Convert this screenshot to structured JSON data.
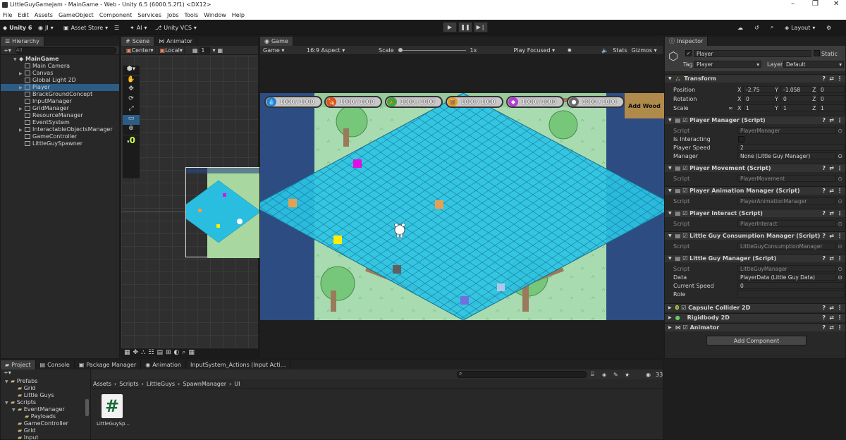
{
  "window": {
    "title": "LittleGuyGamejam - MainGame - Web - Unity 6.5 (6000.5.2f1) <DX12>"
  },
  "menu": [
    "File",
    "Edit",
    "Assets",
    "GameObject",
    "Component",
    "Services",
    "Jobs",
    "Tools",
    "Window",
    "Help"
  ],
  "toolbar": {
    "unity": "Unity 6",
    "account": "JI",
    "asset_store": "Asset Store",
    "ai": "AI",
    "vcs": "Unity VCS",
    "layout": "Layout"
  },
  "hierarchy": {
    "tab": "Hierarchy",
    "search_placeholder": "All",
    "scene": "MainGame",
    "items": [
      "Main Camera",
      "Canvas",
      "Global Light 2D",
      "Player",
      "BrackGroundConcept",
      "InputManager",
      "GridManager",
      "ResourceManager",
      "EventSystem",
      "InteractableObjectsManager",
      "GameController",
      "LittleGuySpawner"
    ]
  },
  "scene": {
    "tab": "Scene",
    "tab2": "Animator",
    "pivot": "Center",
    "space": "Local",
    "grid": "1",
    "zero": "0"
  },
  "game": {
    "tab": "Game",
    "display": "Game",
    "aspect": "16:9 Aspect",
    "scale_label": "Scale",
    "scale_value": "1x",
    "play_mode": "Play Focused",
    "stats": "Stats",
    "gizmos": "Gizmos",
    "hud": [
      "1000 / 1000",
      "1000 / 1000",
      "1000 / 1000",
      "1000 / 1000",
      "1000 / 1000",
      "1000 / 1000"
    ],
    "hud_colors": [
      "#2a7fd4",
      "#d9541a",
      "#3fa83f",
      "#e0a020",
      "#b040d0",
      "#6a6a6a"
    ],
    "add_wood": "Add Wood"
  },
  "inspector": {
    "tab": "Inspector",
    "object_name": "Player",
    "static": "Static",
    "tag_label": "Tag",
    "tag": "Player",
    "layer_label": "Layer",
    "layer": "Default",
    "transform": {
      "title": "Transform",
      "position": {
        "label": "Position",
        "x": "-2.75",
        "y": "-1.058",
        "z": "0"
      },
      "rotation": {
        "label": "Rotation",
        "x": "0",
        "y": "0",
        "z": "0"
      },
      "scale": {
        "label": "Scale",
        "x": "1",
        "y": "1",
        "z": "1"
      }
    },
    "components": [
      {
        "title": "Player Manager (Script)",
        "script": "PlayerManager"
      },
      {
        "title": "Player Movement (Script)",
        "script": "PlayerMovement"
      },
      {
        "title": "Player Animation Manager (Script)",
        "script": "PlayerAnimationManager"
      },
      {
        "title": "Player Interact (Script)",
        "script": "PlayerInteract"
      },
      {
        "title": "Little Guy Consumption Manager (Script)",
        "script": "LittleGuyConsumptionManager"
      },
      {
        "title": "Little Guy Manager (Script)",
        "script": "LittleGuyManager"
      }
    ],
    "script_label": "Script",
    "pm_fields": {
      "is_interacting": "Is Interacting",
      "player_speed": "Player Speed",
      "player_speed_value": "2",
      "manager": "Manager",
      "manager_value": "None (Little Guy Manager)"
    },
    "lgm_fields": {
      "data": "Data",
      "data_value": "PlayerData (Little Guy Data)",
      "current_speed": "Current Speed",
      "current_speed_value": "0",
      "role": "Role"
    },
    "extra": [
      "Capsule Collider 2D",
      "Rigidbody 2D",
      "Animator"
    ],
    "add_component": "Add Component"
  },
  "project": {
    "tabs": [
      "Project",
      "Console",
      "Package Manager",
      "Animation",
      "InputSystem_Actions (Input Acti..."
    ],
    "breadcrumb": [
      "Assets",
      "Scripts",
      "LittleGuys",
      "SpawnManager",
      "UI"
    ],
    "tree": [
      "Prefabs",
      "Grid",
      "Little Guys",
      "Scripts",
      "EventManager",
      "Payloads",
      "GameController",
      "Grid",
      "Input"
    ],
    "file": "LittleGuySp...",
    "count": "33"
  }
}
